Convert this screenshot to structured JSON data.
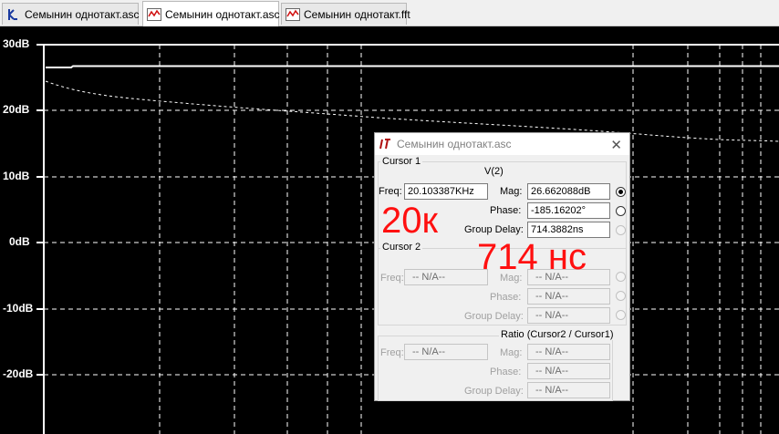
{
  "tabs": [
    {
      "label": "Семынин однотакт.asc",
      "icon": "schematic-icon"
    },
    {
      "label": "Семынин однотакт.asc",
      "icon": "waveform-icon"
    },
    {
      "label": "Семынин однотакт.fft",
      "icon": "waveform-icon"
    }
  ],
  "plot": {
    "y_labels": [
      "30dB",
      "20dB",
      "10dB",
      "0dB",
      "-10dB",
      "-20dB"
    ],
    "colors": {
      "background": "#000000",
      "grid": "#ffffff",
      "trace": "#ffffff"
    }
  },
  "dialog": {
    "title": "Семынин однотакт.asc",
    "cursor1": {
      "group_label": "Cursor 1",
      "trace_name": "V(2)",
      "freq_label": "Freq:",
      "freq_value": "20.103387KHz",
      "mag_label": "Mag:",
      "mag_value": "26.662088dB",
      "phase_label": "Phase:",
      "phase_value": "-185.16202°",
      "delay_label": "Group Delay:",
      "delay_value": "714.3882ns"
    },
    "cursor2": {
      "group_label": "Cursor 2",
      "freq_label": "Freq:",
      "freq_value": "-- N/A--",
      "mag_label": "Mag:",
      "mag_value": "-- N/A--",
      "phase_label": "Phase:",
      "phase_value": "-- N/A--",
      "delay_label": "Group Delay:",
      "delay_value": "-- N/A--"
    },
    "ratio": {
      "group_label": "Ratio (Cursor2 / Cursor1)",
      "freq_label": "Freq:",
      "freq_value": "-- N/A--",
      "mag_label": "Mag:",
      "mag_value": "-- N/A--",
      "phase_label": "Phase:",
      "phase_value": "-- N/A--",
      "delay_label": "Group Delay:",
      "delay_value": "-- N/A--"
    }
  },
  "annotations": {
    "freq_note": "20к",
    "delay_note": "714 нс",
    "color": "#ff1010"
  }
}
